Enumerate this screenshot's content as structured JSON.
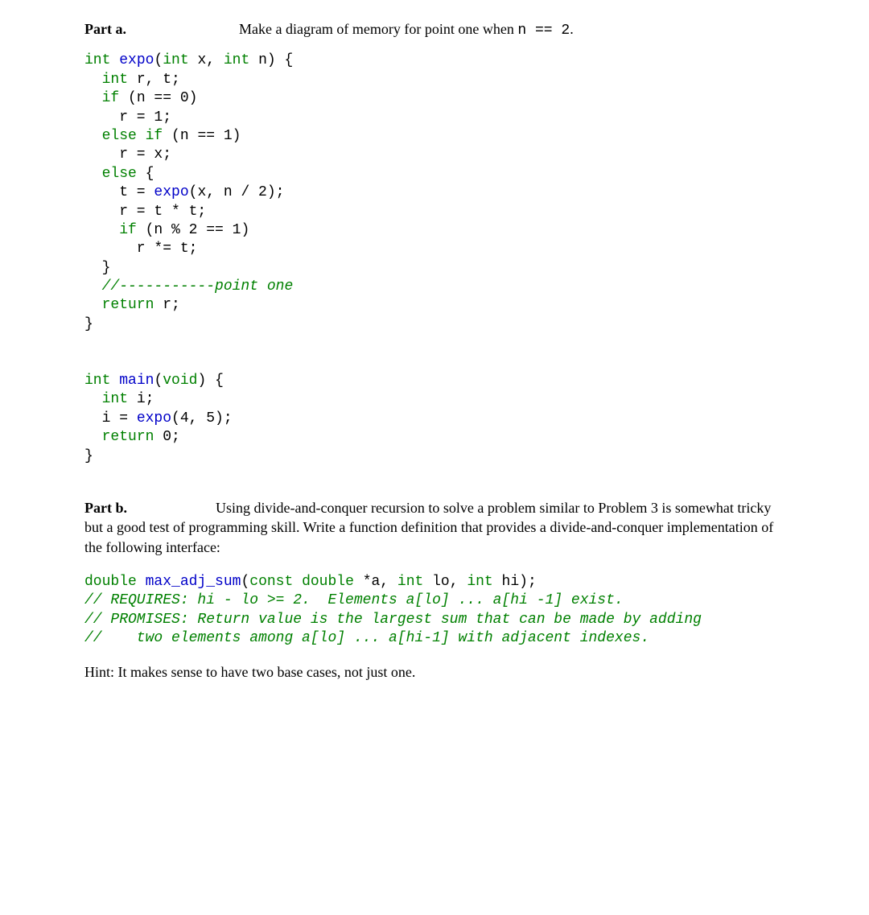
{
  "partA": {
    "label": "Part a.",
    "prompt_before": "Make a diagram of memory for point one when ",
    "prompt_code": "n == 2",
    "prompt_after": ".",
    "code": {
      "sig_pre": "int ",
      "sig_fn": "expo",
      "sig_post1": "(",
      "sig_kw1": "int",
      "sig_post2": " x, ",
      "sig_kw2": "int",
      "sig_post3": " n) {",
      "l2a": "  ",
      "l2b": "int",
      "l2c": " r, t;",
      "l3a": "  ",
      "l3b": "if",
      "l3c": " (n == 0)",
      "l4": "    r = 1;",
      "l5a": "  ",
      "l5b": "else if",
      "l5c": " (n == 1)",
      "l6": "    r = x;",
      "l7a": "  ",
      "l7b": "else",
      "l7c": " {",
      "l8a": "    t = ",
      "l8b": "expo",
      "l8c": "(x, n / 2);",
      "l9": "    r = t * t;",
      "l10a": "    ",
      "l10b": "if",
      "l10c": " (n % 2 == 1)",
      "l11": "      r *= t;",
      "l12": "  }",
      "l13": "  //-----------point one",
      "l14a": "  ",
      "l14b": "return",
      "l14c": " r;",
      "l15": "}",
      "m1a": "int ",
      "m1b": "main",
      "m1c": "(",
      "m1d": "void",
      "m1e": ") {",
      "m2a": "  ",
      "m2b": "int",
      "m2c": " i;",
      "m3a": "  i = ",
      "m3b": "expo",
      "m3c": "(4, 5);",
      "m4a": "  ",
      "m4b": "return",
      "m4c": " 0;",
      "m5": "}"
    }
  },
  "partB": {
    "label": "Part b.",
    "text": "Using divide-and-conquer recursion to solve a problem similar to Problem 3 is somewhat tricky but a good test of programming skill. Write a function definition that provides a divide-and-conquer implementation of the following interface:",
    "code": {
      "l1a": "double ",
      "l1b": "max_adj_sum",
      "l1c": "(",
      "l1d": "const double",
      "l1e": " *a, ",
      "l1f": "int",
      "l1g": " lo, ",
      "l1h": "int",
      "l1i": " hi);",
      "l2": "// REQUIRES: hi - lo >= 2.  Elements a[lo] ... a[hi -1] exist.",
      "l3": "// PROMISES: Return value is the largest sum that can be made by adding",
      "l4": "//    two elements among a[lo] ... a[hi-1] with adjacent indexes."
    },
    "hint": "Hint: It makes sense to have two base cases, not just one."
  }
}
